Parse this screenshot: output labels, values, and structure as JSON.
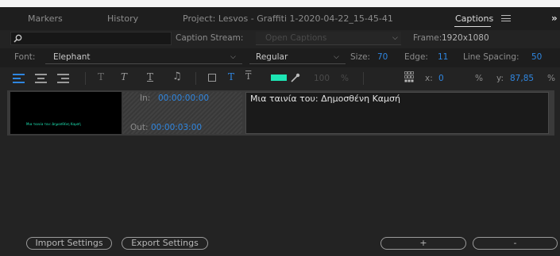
{
  "tabs": {
    "markers": "Markers",
    "history": "History",
    "project": "Project: Lesvos - Graffiti 1-2020-04-22_15-45-41",
    "captions": "Captions"
  },
  "stream": {
    "label": "Caption Stream:",
    "value": "Open Captions"
  },
  "frame": {
    "label": "Frame:",
    "value": "1920x1080"
  },
  "font": {
    "label": "Font:",
    "value": "Elephant"
  },
  "style": {
    "value": "Regular"
  },
  "size": {
    "label": "Size:",
    "value": "70"
  },
  "edge": {
    "label": "Edge:",
    "value": "11"
  },
  "line_spacing": {
    "label": "Line Spacing:",
    "value": "50"
  },
  "toolbar": {
    "opacity": "100",
    "opacity_unit": "%",
    "x_label": "x:",
    "x_value": "0",
    "x_unit": "%",
    "y_label": "y:",
    "y_value": "87,85",
    "y_unit": "%",
    "fill_color": "#1de5b4"
  },
  "caption": {
    "in_label": "In:",
    "in_time": "00:00:00:00",
    "out_label": "Out:",
    "out_time": "00:00:03:00",
    "text": "Μια ταινία του: Δημοσθένη Καμσή",
    "thumb_text": "Μια ταινία του: Δημοσθένη Καμσή"
  },
  "buttons": {
    "import": "Import Settings",
    "export": "Export Settings",
    "add": "+",
    "remove": "-"
  }
}
